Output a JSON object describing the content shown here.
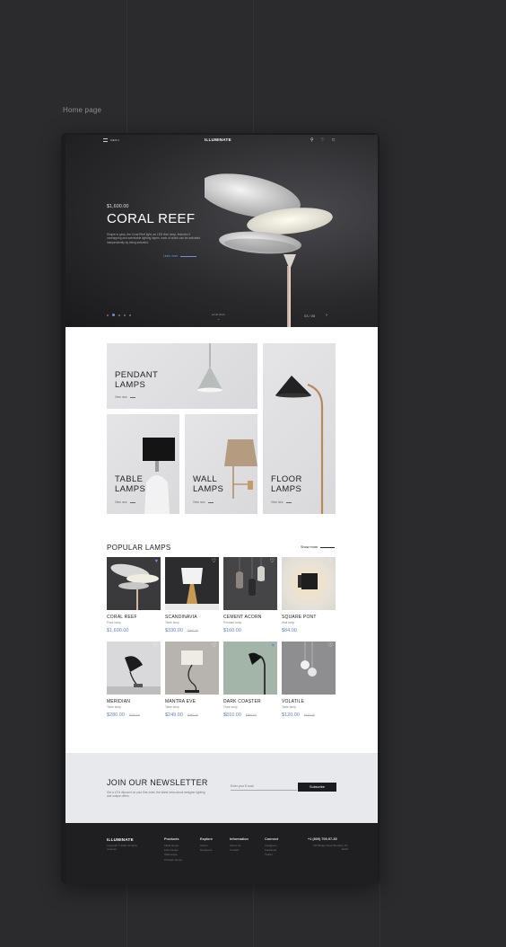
{
  "page_label": "Home page",
  "header": {
    "menu_label": "MENU",
    "brand": "ILLUMINATE",
    "icons": [
      "search-icon",
      "heart-icon",
      "cart-icon"
    ]
  },
  "hero": {
    "price": "$1,600.00",
    "title": "CORAL REEF",
    "description": "Simple in glory, the Coral Reef light, an LED floor lamp, features 3 overlapping and swivelable lighting layers, each of which can be activated independently by being swiveled.",
    "learn_more": "Learn more",
    "scroll_label": "scroll down",
    "counter": "03 / 05",
    "slides_total": 5,
    "active_slide": 2
  },
  "categories": [
    {
      "title_line1": "PENDANT",
      "title_line2": "LAMPS",
      "link": "View now"
    },
    {
      "title_line1": "TABLE",
      "title_line2": "LAMPS",
      "link": "View now"
    },
    {
      "title_line1": "WALL",
      "title_line2": "LAMPS",
      "link": "View now"
    },
    {
      "title_line1": "FLOOR",
      "title_line2": "LAMPS",
      "link": "View now"
    }
  ],
  "popular": {
    "title": "POPULAR LAMPS",
    "show_more": "Show more",
    "products": [
      {
        "name": "CORAL REEF",
        "type": "Floor lamp",
        "price": "$1,600.00",
        "old_price": "",
        "favorited": true
      },
      {
        "name": "SCANDINAVIA",
        "type": "Table lamp",
        "price": "$330.00",
        "old_price": "$360.00",
        "favorited": false
      },
      {
        "name": "CEMENT ACORN",
        "type": "Pendant lamp",
        "price": "$160.00",
        "old_price": "",
        "favorited": false
      },
      {
        "name": "SQUARE PONT",
        "type": "Wall lamp",
        "price": "$84.00",
        "old_price": "",
        "favorited": false
      },
      {
        "name": "MERIDIAN",
        "type": "Table lamp",
        "price": "$280.00",
        "old_price": "$320.00",
        "favorited": false
      },
      {
        "name": "MANTRA EVE",
        "type": "Table lamp",
        "price": "$249.00",
        "old_price": "$280.00",
        "favorited": false
      },
      {
        "name": "DARK COASTER",
        "type": "Floor lamp",
        "price": "$810.00",
        "old_price": "$880.00",
        "favorited": true
      },
      {
        "name": "VOLATILE",
        "type": "Table lamp",
        "price": "$120.00",
        "old_price": "$140.00",
        "favorited": false
      }
    ]
  },
  "newsletter": {
    "title": "JOIN OUR NEWSLETTER",
    "description": "Get a 12% discount on your first order, the latest news about designer lighting and unique offers.",
    "placeholder": "Enter your E-mail",
    "button": "Subscribe"
  },
  "footer": {
    "brand": "ILLUMINATE",
    "copyright": "Copyright © 2020. All rights reserved",
    "columns": [
      {
        "title": "Products",
        "items": [
          "Table lamps",
          "Floor lamps",
          "Wall lamps",
          "Pendant lamps"
        ]
      },
      {
        "title": "Explore",
        "items": [
          "Stores",
          "Designers"
        ]
      },
      {
        "title": "Information",
        "items": [
          "About Us",
          "Contact"
        ]
      },
      {
        "title": "Connect",
        "items": [
          "Instagram",
          "Facebook",
          "Twitter"
        ]
      }
    ],
    "phone": "+1 (800) 709-97-35",
    "address": "125 Bridge Street Brooklyn, NY 11201"
  },
  "colors": {
    "accent": "#5b7fd8",
    "dark": "#1c1c1e",
    "background": "#2b2b2d"
  }
}
